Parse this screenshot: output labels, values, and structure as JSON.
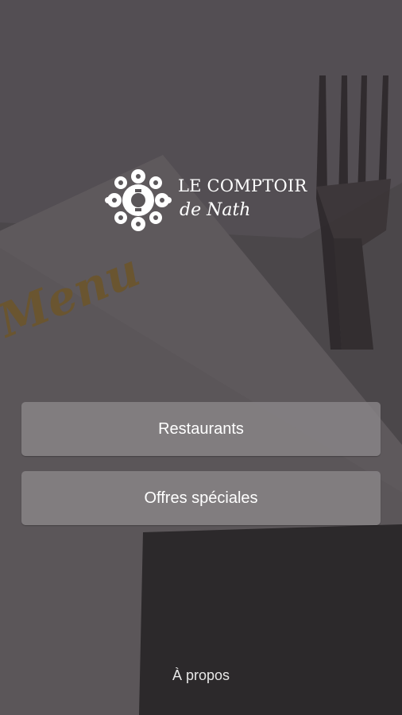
{
  "logo": {
    "line1": "LE COMPTOIR",
    "line2": "de Nath",
    "mark_icon": "lace-flower-icon"
  },
  "background": {
    "menu_word": "Menu",
    "fork_icon": "fork-icon"
  },
  "buttons": {
    "restaurants": "Restaurants",
    "offres": "Offres spéciales"
  },
  "footer": {
    "about": "À propos"
  }
}
